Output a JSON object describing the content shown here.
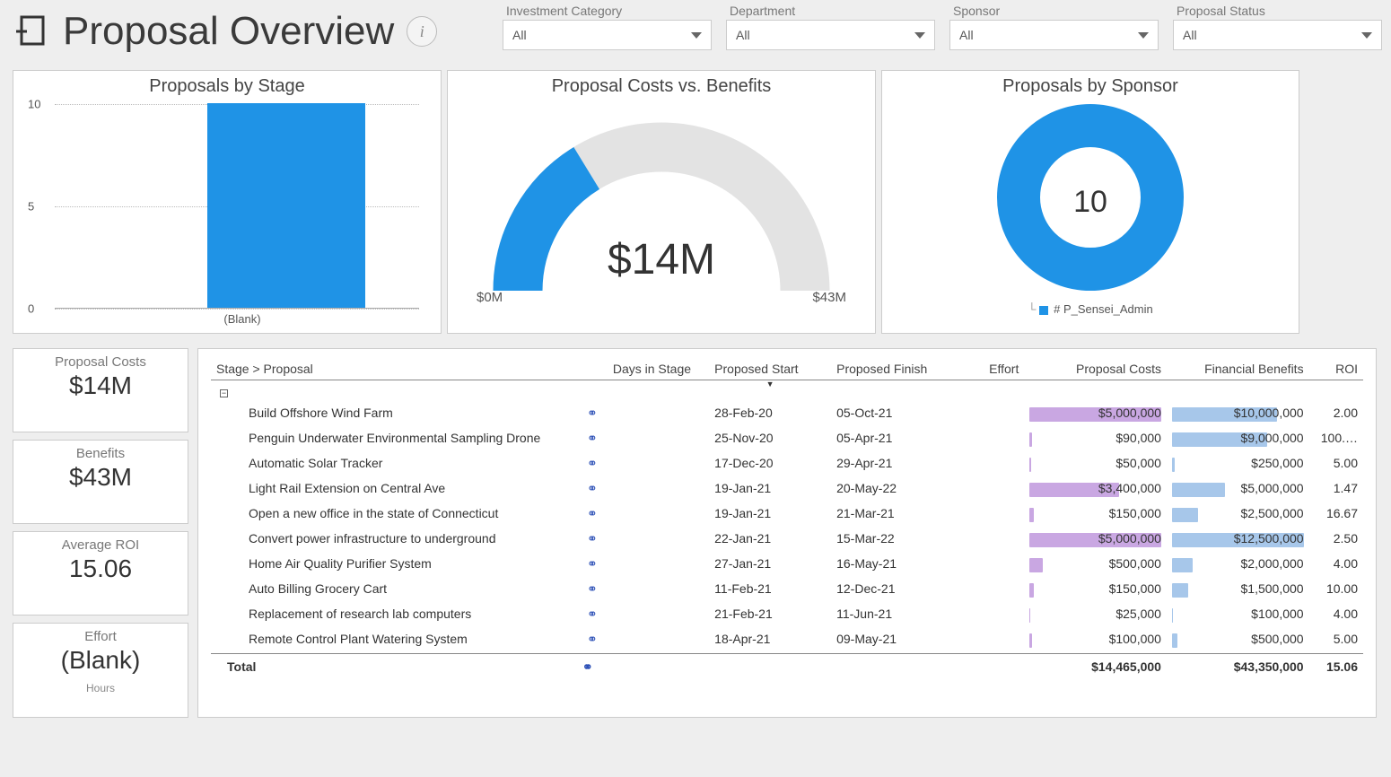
{
  "header": {
    "title": "Proposal Overview"
  },
  "filters": [
    {
      "label": "Investment Category",
      "value": "All"
    },
    {
      "label": "Department",
      "value": "All"
    },
    {
      "label": "Sponsor",
      "value": "All"
    },
    {
      "label": "Proposal Status",
      "value": "All"
    }
  ],
  "stage_chart": {
    "title": "Proposals by Stage"
  },
  "gauge": {
    "title": "Proposal Costs vs. Benefits",
    "value_label": "$14M",
    "min_label": "$0M",
    "max_label": "$43M"
  },
  "donut": {
    "title": "Proposals by Sponsor",
    "center": "10",
    "legend": "# P_Sensei_Admin"
  },
  "cards": {
    "costs": {
      "label": "Proposal Costs",
      "value": "$14M"
    },
    "benefits": {
      "label": "Benefits",
      "value": "$43M"
    },
    "roi": {
      "label": "Average ROI",
      "value": "15.06"
    },
    "effort": {
      "label": "Effort",
      "value": "(Blank)",
      "sub": "Hours"
    }
  },
  "table": {
    "header": {
      "stage": "Stage > Proposal",
      "days": "Days in Stage",
      "start": "Proposed Start",
      "finish": "Proposed Finish",
      "effort": "Effort",
      "costs": "Proposal Costs",
      "ben": "Financial Benefits",
      "roi": "ROI"
    },
    "rows": [
      {
        "name": "Build Offshore Wind Farm",
        "start": "28-Feb-20",
        "finish": "05-Oct-21",
        "cost": "$5,000,000",
        "ben": "$10,000,000",
        "roi": "2.00",
        "c": 5000000,
        "b": 10000000
      },
      {
        "name": "Penguin Underwater Environmental Sampling Drone",
        "start": "25-Nov-20",
        "finish": "05-Apr-21",
        "cost": "$90,000",
        "ben": "$9,000,000",
        "roi": "100.…",
        "c": 90000,
        "b": 9000000
      },
      {
        "name": "Automatic Solar Tracker",
        "start": "17-Dec-20",
        "finish": "29-Apr-21",
        "cost": "$50,000",
        "ben": "$250,000",
        "roi": "5.00",
        "c": 50000,
        "b": 250000
      },
      {
        "name": "Light Rail Extension on Central Ave",
        "start": "19-Jan-21",
        "finish": "20-May-22",
        "cost": "$3,400,000",
        "ben": "$5,000,000",
        "roi": "1.47",
        "c": 3400000,
        "b": 5000000
      },
      {
        "name": "Open a new office in the state of Connecticut",
        "start": "19-Jan-21",
        "finish": "21-Mar-21",
        "cost": "$150,000",
        "ben": "$2,500,000",
        "roi": "16.67",
        "c": 150000,
        "b": 2500000
      },
      {
        "name": "Convert power infrastructure to underground",
        "start": "22-Jan-21",
        "finish": "15-Mar-22",
        "cost": "$5,000,000",
        "ben": "$12,500,000",
        "roi": "2.50",
        "c": 5000000,
        "b": 12500000
      },
      {
        "name": "Home Air Quality Purifier System",
        "start": "27-Jan-21",
        "finish": "16-May-21",
        "cost": "$500,000",
        "ben": "$2,000,000",
        "roi": "4.00",
        "c": 500000,
        "b": 2000000
      },
      {
        "name": "Auto Billing Grocery Cart",
        "start": "11-Feb-21",
        "finish": "12-Dec-21",
        "cost": "$150,000",
        "ben": "$1,500,000",
        "roi": "10.00",
        "c": 150000,
        "b": 1500000
      },
      {
        "name": "Replacement of research lab computers",
        "start": "21-Feb-21",
        "finish": "11-Jun-21",
        "cost": "$25,000",
        "ben": "$100,000",
        "roi": "4.00",
        "c": 25000,
        "b": 100000
      },
      {
        "name": "Remote Control Plant Watering System",
        "start": "18-Apr-21",
        "finish": "09-May-21",
        "cost": "$100,000",
        "ben": "$500,000",
        "roi": "5.00",
        "c": 100000,
        "b": 500000
      }
    ],
    "totals": {
      "label": "Total",
      "cost": "$14,465,000",
      "ben": "$43,350,000",
      "roi": "15.06"
    }
  },
  "chart_data": [
    {
      "type": "bar",
      "title": "Proposals by Stage",
      "categories": [
        "(Blank)"
      ],
      "values": [
        10
      ],
      "ylim": [
        0,
        10
      ],
      "yticks": [
        0,
        5,
        10
      ],
      "xlabel": "",
      "ylabel": ""
    },
    {
      "type": "gauge",
      "title": "Proposal Costs vs. Benefits",
      "value": 14,
      "min": 0,
      "max": 43,
      "unit": "$M"
    },
    {
      "type": "pie",
      "title": "Proposals by Sponsor",
      "series": [
        {
          "name": "# P_Sensei_Admin",
          "value": 10
        }
      ],
      "center_value": 10
    },
    {
      "type": "table",
      "title": "Stage > Proposal",
      "columns": [
        "Proposal",
        "Days in Stage",
        "Proposed Start",
        "Proposed Finish",
        "Effort",
        "Proposal Costs",
        "Financial Benefits",
        "ROI"
      ],
      "rows": [
        [
          "Build Offshore Wind Farm",
          null,
          "28-Feb-20",
          "05-Oct-21",
          null,
          5000000,
          10000000,
          2.0
        ],
        [
          "Penguin Underwater Environmental Sampling Drone",
          null,
          "25-Nov-20",
          "05-Apr-21",
          null,
          90000,
          9000000,
          100.0
        ],
        [
          "Automatic Solar Tracker",
          null,
          "17-Dec-20",
          "29-Apr-21",
          null,
          50000,
          250000,
          5.0
        ],
        [
          "Light Rail Extension on Central Ave",
          null,
          "19-Jan-21",
          "20-May-22",
          null,
          3400000,
          5000000,
          1.47
        ],
        [
          "Open a new office in the state of Connecticut",
          null,
          "19-Jan-21",
          "21-Mar-21",
          null,
          150000,
          2500000,
          16.67
        ],
        [
          "Convert power infrastructure to underground",
          null,
          "22-Jan-21",
          "15-Mar-22",
          null,
          5000000,
          12500000,
          2.5
        ],
        [
          "Home Air Quality Purifier System",
          null,
          "27-Jan-21",
          "16-May-21",
          null,
          500000,
          2000000,
          4.0
        ],
        [
          "Auto Billing Grocery Cart",
          null,
          "11-Feb-21",
          "12-Dec-21",
          null,
          150000,
          1500000,
          10.0
        ],
        [
          "Replacement of research lab computers",
          null,
          "21-Feb-21",
          "11-Jun-21",
          null,
          25000,
          100000,
          4.0
        ],
        [
          "Remote Control Plant Watering System",
          null,
          "18-Apr-21",
          "09-May-21",
          null,
          100000,
          500000,
          5.0
        ]
      ],
      "totals": {
        "Proposal Costs": 14465000,
        "Financial Benefits": 43350000,
        "ROI": 15.06
      }
    }
  ]
}
